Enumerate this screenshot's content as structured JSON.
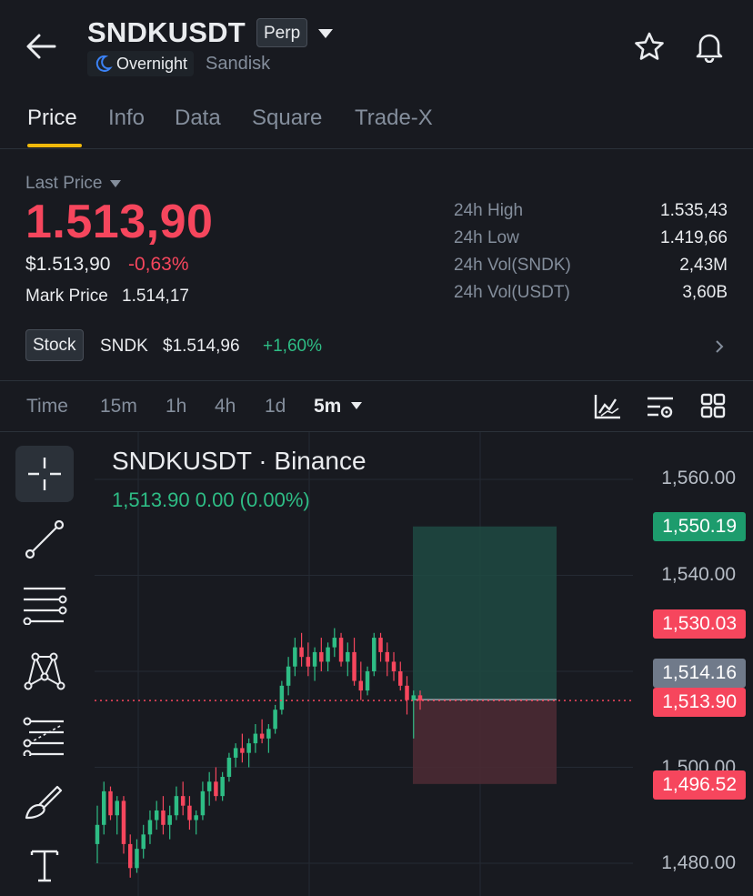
{
  "header": {
    "symbol": "SNDKUSDT",
    "contract_type": "Perp",
    "session": "Overnight",
    "company": "Sandisk"
  },
  "tabs": [
    {
      "label": "Price",
      "active": true
    },
    {
      "label": "Info"
    },
    {
      "label": "Data"
    },
    {
      "label": "Square"
    },
    {
      "label": "Trade-X"
    }
  ],
  "price": {
    "last_price_label": "Last Price",
    "last_price": "1.513,90",
    "usd_price": "$1.513,90",
    "change_pct": "-0,63%",
    "mark_label": "Mark Price",
    "mark_value": "1.514,17"
  },
  "stats": [
    {
      "label": "24h High",
      "value": "1.535,43"
    },
    {
      "label": "24h Low",
      "value": "1.419,66"
    },
    {
      "label": "24h Vol(SNDK)",
      "value": "2,43M"
    },
    {
      "label": "24h Vol(USDT)",
      "value": "3,60B"
    }
  ],
  "stock": {
    "badge": "Stock",
    "ticker": "SNDK",
    "price": "$1.514,96",
    "change": "+1,60%"
  },
  "intervals": [
    {
      "label": "Time"
    },
    {
      "label": "15m"
    },
    {
      "label": "1h"
    },
    {
      "label": "4h"
    },
    {
      "label": "1d"
    },
    {
      "label": "5m",
      "active": true
    }
  ],
  "colors": {
    "up": "#2ebd85",
    "down": "#f6465d",
    "accent": "#f0b90b",
    "background": "#181a20"
  },
  "tools": [
    "crosshair-icon",
    "trend-line-icon",
    "horizontal-lines-icon",
    "pattern-icon",
    "fib-lines-icon",
    "brush-icon",
    "text-icon"
  ],
  "chart": {
    "title": "SNDKUSDT · Binance",
    "ohlc": "1,513.90  0.00 (0.00%)",
    "axis_labels": [
      "1,560.00",
      "1,540.00",
      "1,500.00",
      "1,480.00"
    ],
    "price_tags": {
      "take_profit": "1,550.19",
      "entry": "1,530.03",
      "mark": "1,514.16",
      "last": "1,513.90",
      "stop_loss": "1,496.52"
    }
  },
  "chart_data": {
    "type": "candlestick",
    "interval": "5m",
    "ylim": [
      1478,
      1566
    ],
    "candles": [
      [
        1484,
        1492,
        1480,
        1488
      ],
      [
        1488,
        1497,
        1486,
        1495
      ],
      [
        1495,
        1496,
        1489,
        1490
      ],
      [
        1490,
        1494,
        1486,
        1493
      ],
      [
        1493,
        1494,
        1482,
        1484
      ],
      [
        1484,
        1486,
        1477,
        1479
      ],
      [
        1479,
        1485,
        1478,
        1483
      ],
      [
        1483,
        1488,
        1481,
        1486
      ],
      [
        1486,
        1491,
        1484,
        1489
      ],
      [
        1489,
        1493,
        1487,
        1491
      ],
      [
        1491,
        1494,
        1486,
        1488
      ],
      [
        1488,
        1492,
        1485,
        1490
      ],
      [
        1490,
        1496,
        1489,
        1494
      ],
      [
        1494,
        1497,
        1490,
        1492
      ],
      [
        1492,
        1494,
        1487,
        1489
      ],
      [
        1489,
        1491,
        1486,
        1490
      ],
      [
        1490,
        1497,
        1489,
        1495
      ],
      [
        1495,
        1499,
        1492,
        1497
      ],
      [
        1497,
        1500,
        1493,
        1494
      ],
      [
        1494,
        1499,
        1493,
        1498
      ],
      [
        1498,
        1503,
        1497,
        1502
      ],
      [
        1502,
        1505,
        1500,
        1504
      ],
      [
        1504,
        1507,
        1501,
        1503
      ],
      [
        1503,
        1506,
        1500,
        1505
      ],
      [
        1505,
        1509,
        1503,
        1507
      ],
      [
        1507,
        1510,
        1505,
        1506
      ],
      [
        1506,
        1509,
        1503,
        1508
      ],
      [
        1508,
        1513,
        1507,
        1512
      ],
      [
        1512,
        1518,
        1511,
        1517
      ],
      [
        1517,
        1523,
        1515,
        1521
      ],
      [
        1521,
        1527,
        1519,
        1525
      ],
      [
        1525,
        1528,
        1521,
        1523
      ],
      [
        1523,
        1526,
        1519,
        1521
      ],
      [
        1521,
        1525,
        1518,
        1524
      ],
      [
        1524,
        1527,
        1520,
        1522
      ],
      [
        1522,
        1526,
        1520,
        1525
      ],
      [
        1525,
        1529,
        1523,
        1527
      ],
      [
        1527,
        1528,
        1521,
        1522
      ],
      [
        1522,
        1526,
        1519,
        1524
      ],
      [
        1524,
        1527,
        1517,
        1518
      ],
      [
        1518,
        1522,
        1514,
        1516
      ],
      [
        1516,
        1521,
        1515,
        1520
      ],
      [
        1520,
        1528,
        1519,
        1527
      ],
      [
        1527,
        1528,
        1522,
        1524
      ],
      [
        1524,
        1526,
        1519,
        1522
      ],
      [
        1522,
        1524,
        1518,
        1520
      ],
      [
        1520,
        1522,
        1516,
        1517
      ],
      [
        1517,
        1519,
        1511,
        1514
      ],
      [
        1514,
        1516,
        1506,
        1515
      ],
      [
        1515,
        1516,
        1512,
        1513.9
      ]
    ],
    "annotations": {
      "last_price": 1513.9,
      "take_profit": 1550.19,
      "entry": 1530.03,
      "stop_loss": 1496.52
    }
  }
}
